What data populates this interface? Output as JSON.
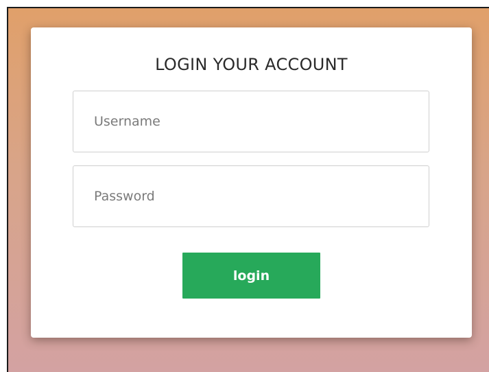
{
  "form": {
    "title": "LOGIN YOUR ACCOUNT",
    "username": {
      "placeholder": "Username",
      "value": ""
    },
    "password": {
      "placeholder": "Password",
      "value": ""
    },
    "submit_label": "login"
  },
  "colors": {
    "background_top": "#e0a06a",
    "background_bottom": "#d3a2a2",
    "card": "#ffffff",
    "button": "#27a95a",
    "button_text": "#ffffff"
  }
}
